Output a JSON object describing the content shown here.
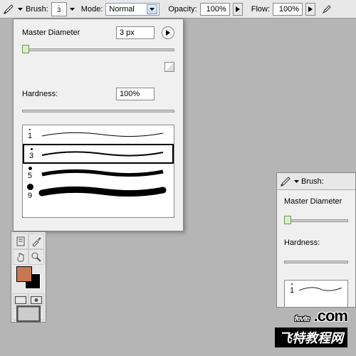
{
  "toolbar": {
    "brush_label": "Brush:",
    "brush_size": "3",
    "mode_label": "Mode:",
    "mode_value": "Normal",
    "opacity_label": "Opacity:",
    "opacity_value": "100%",
    "flow_label": "Flow:",
    "flow_value": "100%"
  },
  "panel": {
    "master_diameter_label": "Master Diameter",
    "master_diameter_value": "3 px",
    "hardness_label": "Hardness:",
    "hardness_value": "100%",
    "brushes": [
      {
        "size": "1"
      },
      {
        "size": "3"
      },
      {
        "size": "5"
      },
      {
        "size": "9"
      }
    ]
  },
  "panel2": {
    "brush_label": "Brush:",
    "master_diameter_label": "Master Diameter",
    "hardness_label": "Hardness:",
    "brushes": [
      {
        "size": "1"
      }
    ]
  },
  "colors": {
    "foreground": "#c87850",
    "background": "#000000"
  },
  "watermark": {
    "line1a": "fevte",
    "line1b": ".com",
    "line2": "飞特教程网"
  }
}
